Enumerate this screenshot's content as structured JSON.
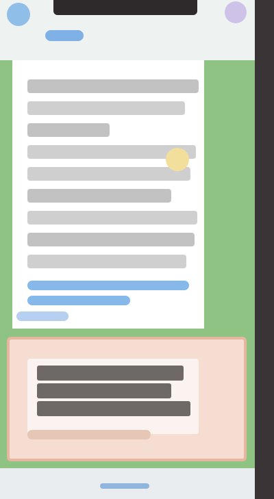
{
  "app": {
    "title": ""
  },
  "topbar": {
    "back_icon": "back-icon",
    "menu_icon": "menu-icon"
  },
  "message": {
    "lines_count": 0
  },
  "colors": {
    "chat_background": "#8fc383",
    "topbar": "#eef3f1",
    "bubble": "#ffffff",
    "highlight": "#e7b69e"
  }
}
